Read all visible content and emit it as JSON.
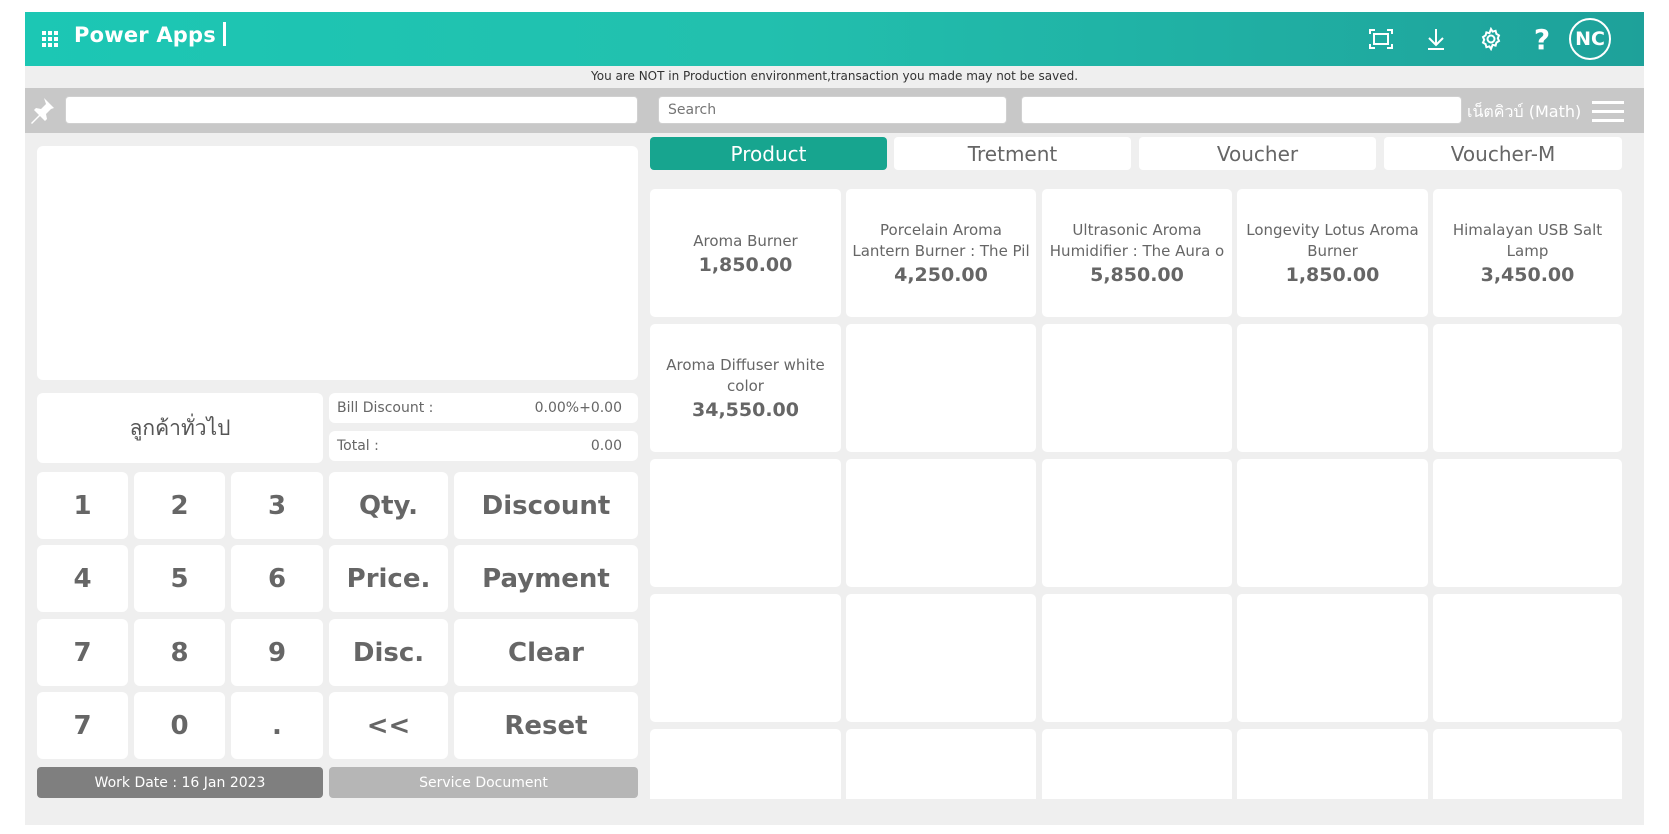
{
  "app": {
    "title": "Power Apps",
    "user_initials": "NC"
  },
  "banner": "You are NOT in Production environment,transaction you made may not be saved.",
  "search": {
    "field1_value": "",
    "search_placeholder": "Search",
    "field3_value": "",
    "user_name": "เน็ตคิวบ์ (Math)"
  },
  "customer": {
    "name": "ลูกค้าทั่วไป"
  },
  "summary": {
    "bill_discount_label": "Bill Discount :",
    "bill_discount_value": "0.00%+0.00",
    "total_label": "Total :",
    "total_value": "0.00"
  },
  "keypad": {
    "k1": "1",
    "k2": "2",
    "k3": "3",
    "k4": "4",
    "k5": "5",
    "k6": "6",
    "k7": "7",
    "k8": "8",
    "k9": "9",
    "k7b": "7",
    "k0": "0",
    "kdot": ".",
    "qty": "Qty.",
    "price": "Price.",
    "disc": "Disc.",
    "back": "<<",
    "discount": "Discount",
    "payment": "Payment",
    "clear": "Clear",
    "reset": "Reset"
  },
  "footer": {
    "work_date": "Work Date : 16 Jan 2023",
    "service_document": "Service Document"
  },
  "tabs": [
    {
      "label": "Product",
      "active": true
    },
    {
      "label": "Tretment",
      "active": false
    },
    {
      "label": "Voucher",
      "active": false
    },
    {
      "label": "Voucher-M",
      "active": false
    }
  ],
  "products": [
    {
      "name": "Aroma Burner",
      "price": "1,850.00"
    },
    {
      "name": "Porcelain Aroma Lantern Burner : The Pil",
      "price": "4,250.00"
    },
    {
      "name": "Ultrasonic Aroma Humidifier : The Aura o",
      "price": "5,850.00"
    },
    {
      "name": "Longevity Lotus Aroma Burner",
      "price": "1,850.00"
    },
    {
      "name": "Himalayan USB Salt Lamp",
      "price": "3,450.00"
    },
    {
      "name": "Aroma Diffuser white color",
      "price": "34,550.00"
    }
  ],
  "colors": {
    "accent": "#17a58f",
    "header_start": "#1cc7b4",
    "header_end": "#1ea19a"
  },
  "icons": [
    "waffle-icon",
    "fit-screen-icon",
    "download-icon",
    "gear-icon",
    "help-icon",
    "pin-icon",
    "hamburger-icon"
  ]
}
